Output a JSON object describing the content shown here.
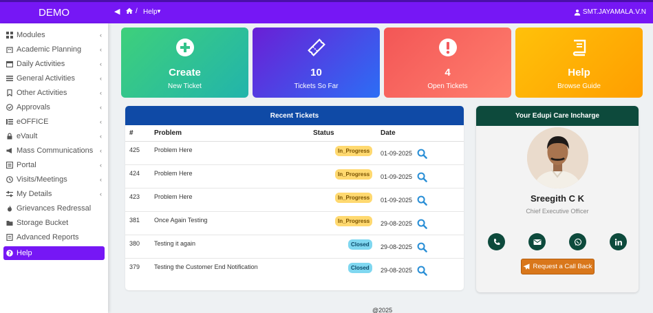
{
  "brand": "DEMO",
  "breadcrumb": {
    "current": "Help"
  },
  "user": {
    "name": "SMT.JAYAMALA.V.N"
  },
  "sidebar": {
    "items": [
      {
        "label": "Modules",
        "icon": "grid-icon"
      },
      {
        "label": "Academic Planning",
        "icon": "building-icon"
      },
      {
        "label": "Daily Activities",
        "icon": "calendar-icon"
      },
      {
        "label": "General Activities",
        "icon": "list-icon"
      },
      {
        "label": "Other Activities",
        "icon": "bookmark-icon"
      },
      {
        "label": "Approvals",
        "icon": "approval-icon"
      },
      {
        "label": "eOFFICE",
        "icon": "office-icon"
      },
      {
        "label": "eVault",
        "icon": "folder-lock-icon"
      },
      {
        "label": "Mass Communications",
        "icon": "megaphone-icon"
      },
      {
        "label": "Portal",
        "icon": "portal-icon"
      },
      {
        "label": "Visits/Meetings",
        "icon": "clock-icon"
      },
      {
        "label": "My Details",
        "icon": "sliders-icon"
      },
      {
        "label": "Grievances Redressal",
        "icon": "fire-icon"
      },
      {
        "label": "Storage Bucket",
        "icon": "folder-icon"
      },
      {
        "label": "Advanced Reports",
        "icon": "report-icon"
      },
      {
        "label": "Help",
        "icon": "help-icon"
      }
    ]
  },
  "cards": [
    {
      "big": "Create",
      "small": "New Ticket",
      "icon": "plus-circle-icon"
    },
    {
      "big": "10",
      "small": "Tickets So Far",
      "icon": "ticket-icon"
    },
    {
      "big": "4",
      "small": "Open Tickets",
      "icon": "exclamation-icon"
    },
    {
      "big": "Help",
      "small": "Browse Guide",
      "icon": "book-icon"
    }
  ],
  "tickets": {
    "title": "Recent Tickets",
    "columns": [
      "#",
      "Problem",
      "Status",
      "Date"
    ],
    "rows": [
      {
        "id": "425",
        "problem": "Problem Here",
        "status": "In_Progress",
        "date": "01-09-2025"
      },
      {
        "id": "424",
        "problem": "Problem Here",
        "status": "In_Progress",
        "date": "01-09-2025"
      },
      {
        "id": "423",
        "problem": "Problem Here",
        "status": "In_Progress",
        "date": "01-09-2025"
      },
      {
        "id": "381",
        "problem": "Once Again Testing",
        "status": "In_Progress",
        "date": "29-08-2025"
      },
      {
        "id": "380",
        "problem": "Testing it again",
        "status": "Closed",
        "date": "29-08-2025"
      },
      {
        "id": "379",
        "problem": "Testing the Customer End Notification",
        "status": "Closed",
        "date": "29-08-2025"
      }
    ]
  },
  "incharge": {
    "title": "Your Edupi Care Incharge",
    "name": "Sreegith C K",
    "role": "Chief Executive Officer",
    "callback_label": "Request a Call Back"
  },
  "footer": "@2025",
  "colors": {
    "topbar": "#7617f5",
    "card_create": "#3cc48f",
    "card_tickets": "#4a4df0",
    "card_open": "#f45a5f",
    "card_help": "#ffb300",
    "tickets_header": "#0f4aa6",
    "incharge_header": "#0d4a3c"
  }
}
